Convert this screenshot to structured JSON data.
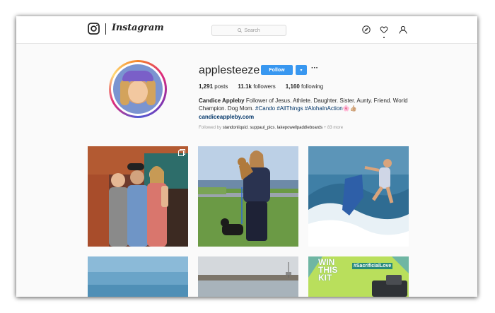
{
  "header": {
    "logo_text": "Instagram",
    "search_placeholder": "Search",
    "icons": [
      "instagram-camera-icon",
      "search-icon",
      "explore-compass-icon",
      "activity-heart-icon",
      "profile-user-icon"
    ]
  },
  "profile": {
    "username": "applesteeze",
    "follow_label": "Follow",
    "dropdown_label": "▾",
    "more_label": "···",
    "stats": [
      {
        "count": "1,291",
        "label": "posts"
      },
      {
        "count": "11.1k",
        "label": "followers"
      },
      {
        "count": "1,160",
        "label": "following"
      }
    ],
    "bio_name": "Candice Appleby",
    "bio_text": "Follower of Jesus. Athlete. Daughter. Sister. Aunty. Friend. World Champion. Dog Mom.",
    "bio_tags": [
      "#Cando",
      "#AllThings",
      "#AlohaInAction"
    ],
    "bio_emoji": "🌸👍🏼",
    "website": "candiceappleby.com",
    "followed_prefix": "Followed by",
    "followed_by": [
      "standonliquid",
      "suppaul_pics",
      "lakepowellpaddleboards"
    ],
    "followed_more": "+ 83 more"
  },
  "posts": [
    {
      "name": "post-friends-medals",
      "multi": true
    },
    {
      "name": "post-dog-park",
      "multi": false
    },
    {
      "name": "post-surfing-wave",
      "multi": false
    },
    {
      "name": "post-ocean-beach",
      "multi": false
    },
    {
      "name": "post-jetty-water",
      "multi": false
    },
    {
      "name": "post-win-this-kit",
      "multi": false,
      "text_line1": "WIN",
      "text_line2": "THIS",
      "text_line3": "KIT",
      "hashtag": "#SacrificialLove"
    }
  ],
  "colors": {
    "follow_blue": "#3897f0",
    "link_dark_blue": "#003569",
    "text": "#262626",
    "muted": "#999999"
  }
}
